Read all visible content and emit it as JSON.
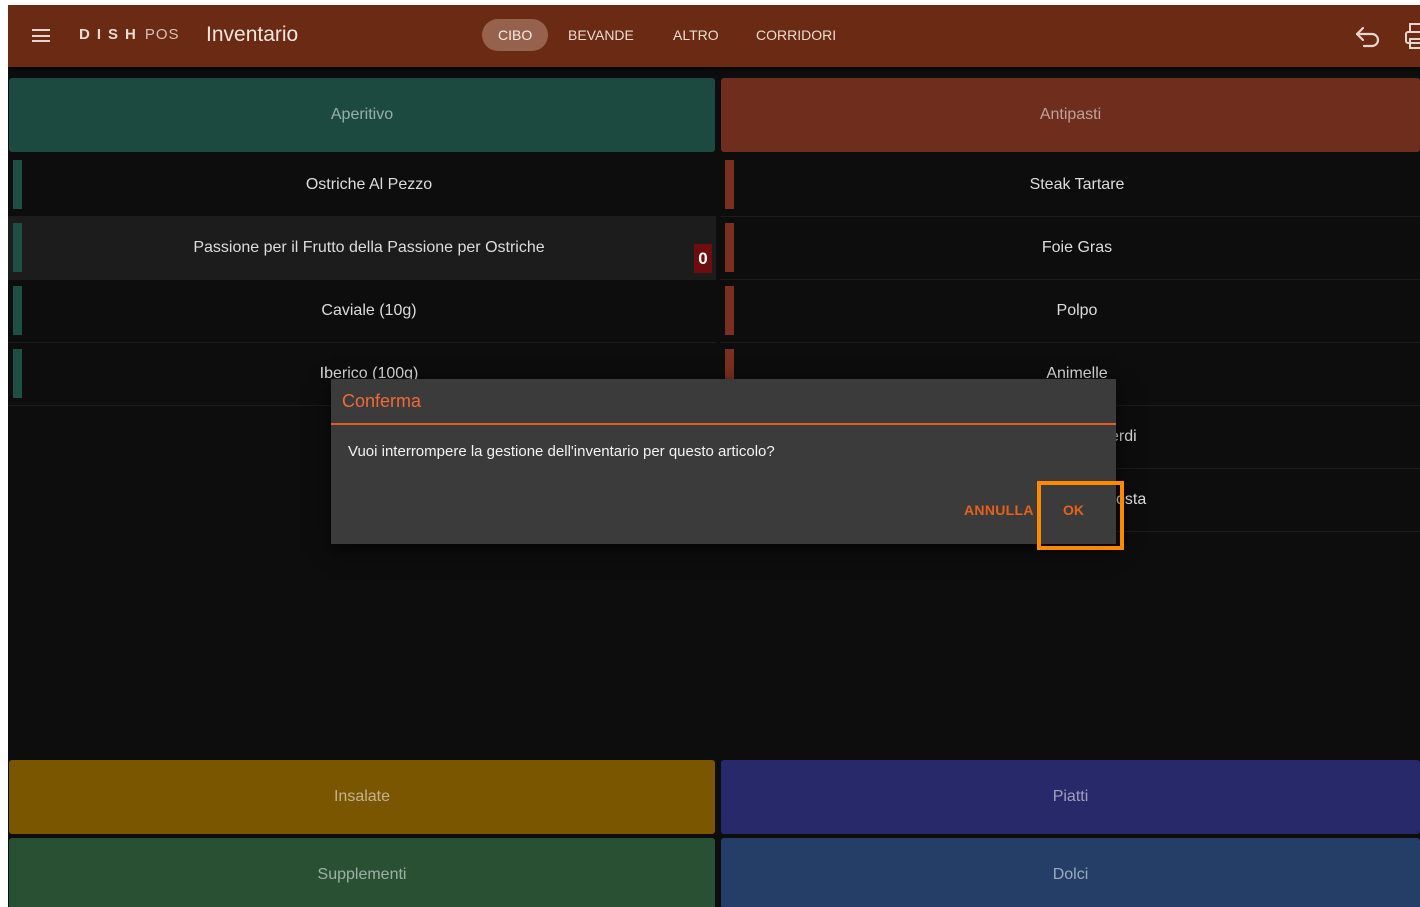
{
  "app": {
    "brand_strong": "DISH",
    "brand_light": "POS",
    "screen_title": "Inventario"
  },
  "tabs": [
    {
      "label": "CIBO",
      "active": true
    },
    {
      "label": "BEVANDE",
      "active": false
    },
    {
      "label": "ALTRO",
      "active": false
    },
    {
      "label": "CORRIDORI",
      "active": false
    }
  ],
  "icons": {
    "menu": "menu-icon",
    "undo": "undo-icon",
    "print": "print-icon"
  },
  "categories": {
    "aperitivo": "Aperitivo",
    "antipasti": "Antipasti",
    "insalate": "Insalate",
    "piatti": "Piatti",
    "supplementi": "Supplementi",
    "dolci": "Dolci"
  },
  "aperitivo_items": [
    "Ostriche Al Pezzo",
    "Passione per il Frutto della Passione per Ostriche",
    "Caviale (10g)",
    "Iberico (100g)"
  ],
  "antipasti_items": [
    "Steak Tartare",
    "Foie Gras",
    "Polpo",
    "Animelle",
    "erdi",
    "osta"
  ],
  "highlighted_item_count": "0",
  "dialog": {
    "title": "Conferma",
    "message": "Vuoi interrompere la gestione dell'inventario per questo articolo?",
    "cancel_label": "ANNULLA",
    "ok_label": "OK"
  },
  "colors": {
    "topbar": "#6a2a13",
    "aperitivo": "#1c4a41",
    "antipasti": "#6e2d1d",
    "insalate": "#7b5600",
    "piatti": "#28296b",
    "supplementi": "#295033",
    "dolci": "#243e68",
    "dialog_accent": "#e35a2a",
    "highlight_box": "#ff8a00"
  }
}
